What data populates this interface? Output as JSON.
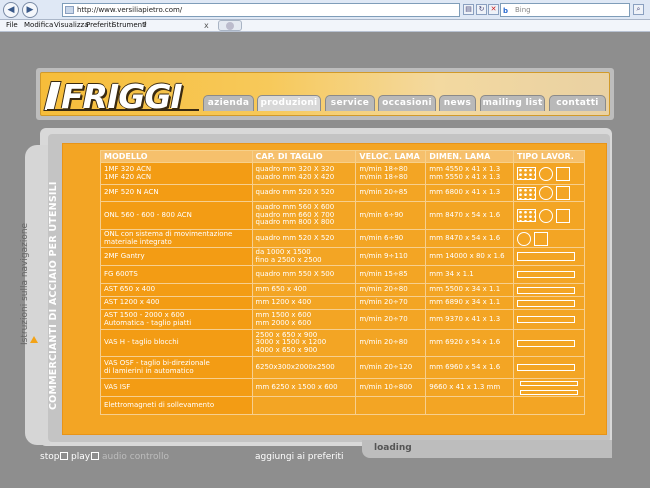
{
  "browser": {
    "url": "http://www.versiliapietro.com/",
    "search_placeholder": "Bing",
    "search_brand": "b",
    "menu": [
      "File",
      "Modifica",
      "Visualizza",
      "Preferiti",
      "Strumenti",
      "?"
    ],
    "tab_close": "x"
  },
  "header": {
    "logo": "FRIGGI",
    "tabs": [
      "azienda",
      "produzioni",
      "service",
      "occasioni",
      "news",
      "mailing list",
      "contatti"
    ]
  },
  "sidebar": {
    "label": "Istruzioni sulla navigazione"
  },
  "main": {
    "vertical_title": "COMMERCIANTI DI ACCIAIO PER UTENSILI",
    "columns": [
      "MODELLO",
      "CAP. DI TAGLIO",
      "VELOC. LAMA",
      "DIMEN. LAMA",
      "TIPO  LAVOR."
    ],
    "rows": [
      {
        "model": [
          "1MF  320 ACN",
          "1MF  420 ACN"
        ],
        "cap": [
          "quadro mm 320 X 320",
          "quadro mm 420 X 420"
        ],
        "vel": [
          "m/min 18÷80",
          "m/min 18÷80"
        ],
        "dim": [
          "mm 4550 x 41 x 1.3",
          "mm 5550 x 41 x 1.3"
        ],
        "shapes": [
          "grid",
          "circle",
          "square"
        ]
      },
      {
        "model": [
          "2MF  520 N ACN"
        ],
        "cap": [
          "quadro mm 520 X 520"
        ],
        "vel": [
          "m/min 20÷85"
        ],
        "dim": [
          "mm 6800 x 41 x 1.3"
        ],
        "shapes": [
          "grid",
          "circle",
          "square"
        ]
      },
      {
        "model": [
          "ONL  560 - 600 - 800 ACN"
        ],
        "cap": [
          "quadro mm 560 X 600",
          "quadro mm 660 X 700",
          "quadro mm 800 X 800"
        ],
        "vel": [
          "m/min 6÷90"
        ],
        "dim": [
          "mm 8470 x 54 x 1.6"
        ],
        "shapes": [
          "grid",
          "circle",
          "square"
        ]
      },
      {
        "model": [
          "ONL con sistema di movimentazione",
          "materiale integrato"
        ],
        "cap": [
          "quadro mm 520 X 520"
        ],
        "vel": [
          "m/min 6÷90"
        ],
        "dim": [
          "mm 8470 x 54 x 1.6"
        ],
        "shapes": [
          "circle",
          "square"
        ]
      },
      {
        "model": [
          "2MF  Gantry"
        ],
        "cap": [
          "da 1000 x 1500",
          "fino a 2500 x 2500"
        ],
        "vel": [
          "m/min 9÷110"
        ],
        "dim": [
          "mm 14000 x 80 x 1.6"
        ],
        "shapes": [
          "rect"
        ]
      },
      {
        "model": [
          "FG   600TS"
        ],
        "cap": [
          "quadro mm 550 X 500"
        ],
        "vel": [
          "m/min 15÷85"
        ],
        "dim": [
          "mm 34 x 1.1"
        ],
        "shapes": [
          "rect-s"
        ]
      },
      {
        "model": [
          "AST  650 x 400"
        ],
        "cap": [
          "mm 650 x 400"
        ],
        "vel": [
          "m/min 20÷80"
        ],
        "dim": [
          "mm 5500 x 34 x 1.1"
        ],
        "shapes": [
          "rect-s"
        ]
      },
      {
        "model": [
          "AST  1200 x 400"
        ],
        "cap": [
          "mm 1200 x 400"
        ],
        "vel": [
          "m/min 20÷70"
        ],
        "dim": [
          "mm 6890 x 34 x 1.1"
        ],
        "shapes": [
          "rect-s"
        ]
      },
      {
        "model": [
          "AST  1500 - 2000 x 600",
          "Automatica - taglio piatti"
        ],
        "cap": [
          "mm 1500 x 600",
          "mm 2000 x 600"
        ],
        "vel": [
          "m/min 20÷70"
        ],
        "dim": [
          "mm 9370 x 41 x 1.3"
        ],
        "shapes": [
          "rect-s"
        ]
      },
      {
        "model": [
          "VAS H - taglio blocchi"
        ],
        "cap": [
          "2500 x 650 x 900",
          "3000 x 1500 x 1200",
          "4000 x 650 x 900"
        ],
        "vel": [
          "m/min 20÷80"
        ],
        "dim": [
          "mm 6920 x 54 x 1.6"
        ],
        "shapes": [
          "rect-s"
        ]
      },
      {
        "model": [
          "VAS OSF - taglio bi-direzionale",
          "di lamierini in automatico"
        ],
        "cap": [
          "6250x300x2000x2500"
        ],
        "vel": [
          "m/min 20÷120"
        ],
        "dim": [
          "mm 6960 x 54 x 1.6"
        ],
        "shapes": [
          "rect-s"
        ]
      },
      {
        "model": [
          "VAS ISF"
        ],
        "cap": [
          "mm 6250 x 1500 x 600"
        ],
        "vel": [
          "m/min 10÷800"
        ],
        "dim": [
          "9660 x 41 x 1.3 mm"
        ],
        "shapes": [
          "rect2"
        ]
      },
      {
        "model": [
          "Elettromagneti di sollevamento"
        ],
        "cap": [
          ""
        ],
        "vel": [
          ""
        ],
        "dim": [
          ""
        ],
        "shapes": []
      }
    ]
  },
  "footer": {
    "stop": "stop",
    "play": "play",
    "audio": "audio controllo",
    "favorites": "aggiungi ai preferiti",
    "loading": "loading"
  }
}
